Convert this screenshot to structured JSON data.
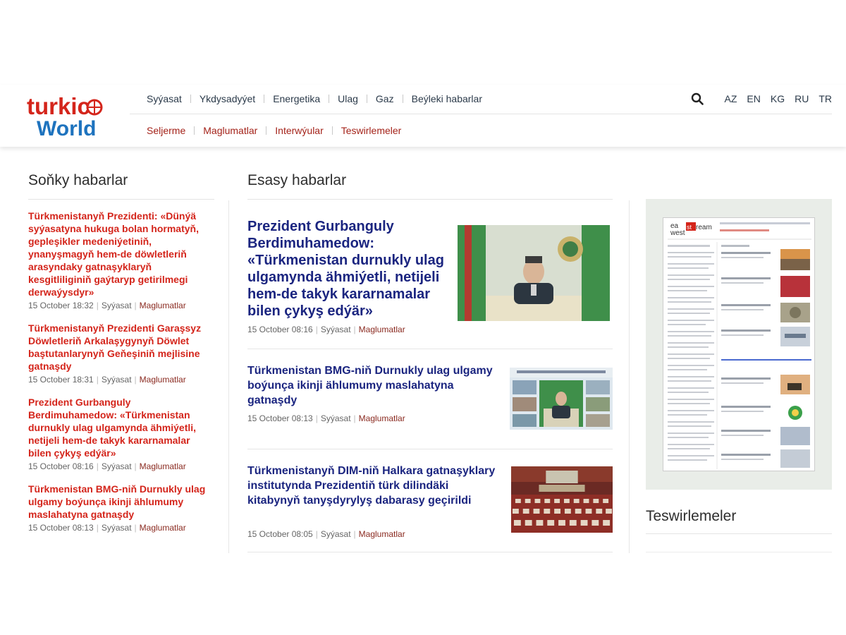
{
  "brand": {
    "name": "turkic World",
    "logo_top": "turkic",
    "logo_bottom": "World",
    "colors": {
      "red": "#d4251b",
      "blue": "#1e73be",
      "navy": "#1b2580",
      "dark_red": "#a4231a"
    }
  },
  "nav": {
    "primary": [
      "Syýasat",
      "Ykdysadyýet",
      "Energetika",
      "Ulag",
      "Gaz",
      "Beýleki habarlar"
    ],
    "secondary": [
      "Seljerme",
      "Maglumatlar",
      "Interwýular",
      "Teswirlemeler"
    ],
    "languages": [
      "AZ",
      "EN",
      "KG",
      "RU",
      "TR"
    ],
    "search_icon": "search-icon"
  },
  "latest": {
    "title": "Soňky habarlar",
    "items": [
      {
        "title": "Türkmenistanyň Prezidenti: «Dünýä syýasatyna hukuga bolan hormatyň, gepleşikler medeniýetiniň, ynanyşmagyň hem-de döwletleriň arasyndaky gatnaşyklaryň kesgitliliginiň gaýtaryp getirilmegi derwaýysdyr»",
        "time": "15 October 18:32",
        "category": "Syýasat",
        "tag": "Maglumatlar"
      },
      {
        "title": "Türkmenistanyň Prezidenti Garaşsyz Döwletleriň Arkalaşygynyň Döwlet baştutanlarynyň Geňeşiniň mejlisine gatnaşdy",
        "time": "15 October 18:31",
        "category": "Syýasat",
        "tag": "Maglumatlar"
      },
      {
        "title": "Prezident Gurbanguly Berdimuhamedow: «Türkmenistan durnukly ulag ulgamynda ähmiýetli, netijeli hem-de takyk kararnamalar bilen çykyş edýär»",
        "time": "15 October 08:16",
        "category": "Syýasat",
        "tag": "Maglumatlar"
      },
      {
        "title": "Türkmenistan BMG-niň Durnukly ulag ulgamy boýunça ikinji ählumumy maslahatyna gatnaşdy",
        "time": "15 October 08:13",
        "category": "Syýasat",
        "tag": "Maglumatlar"
      }
    ]
  },
  "main_news": {
    "title": "Esasy habarlar",
    "items": [
      {
        "title": "Prezident Gurbanguly Berdimuhamedow: «Türkmenistan durnukly ulag ulgamynda ähmiýetli, netijeli hem-de takyk kararnamalar bilen çykyş edýär»",
        "time": "15 October 08:16",
        "category": "Syýasat",
        "tag": "Maglumatlar"
      },
      {
        "title": "Türkmenistan BMG-niň Durnukly ulag ulgamy boýunça ikinji ählumumy maslahatyna gatnaşdy",
        "time": "15 October 08:13",
        "category": "Syýasat",
        "tag": "Maglumatlar"
      },
      {
        "title": "Türkmenistanyň DIM-niň Halkara gatnaşyklary institutynda Prezidentiň türk dilindäki kitabynyň tanyşdyrylyş dabarasy geçirildi",
        "time": "15 October 08:05",
        "category": "Syýasat",
        "tag": "Maglumatlar"
      }
    ]
  },
  "sidebar": {
    "ad_brand_top": "ea",
    "ad_brand_bottom": "west",
    "ad_brand_suffix": "ream",
    "ad_brand_mid": "st",
    "section_title": "Teswirlemeler"
  }
}
